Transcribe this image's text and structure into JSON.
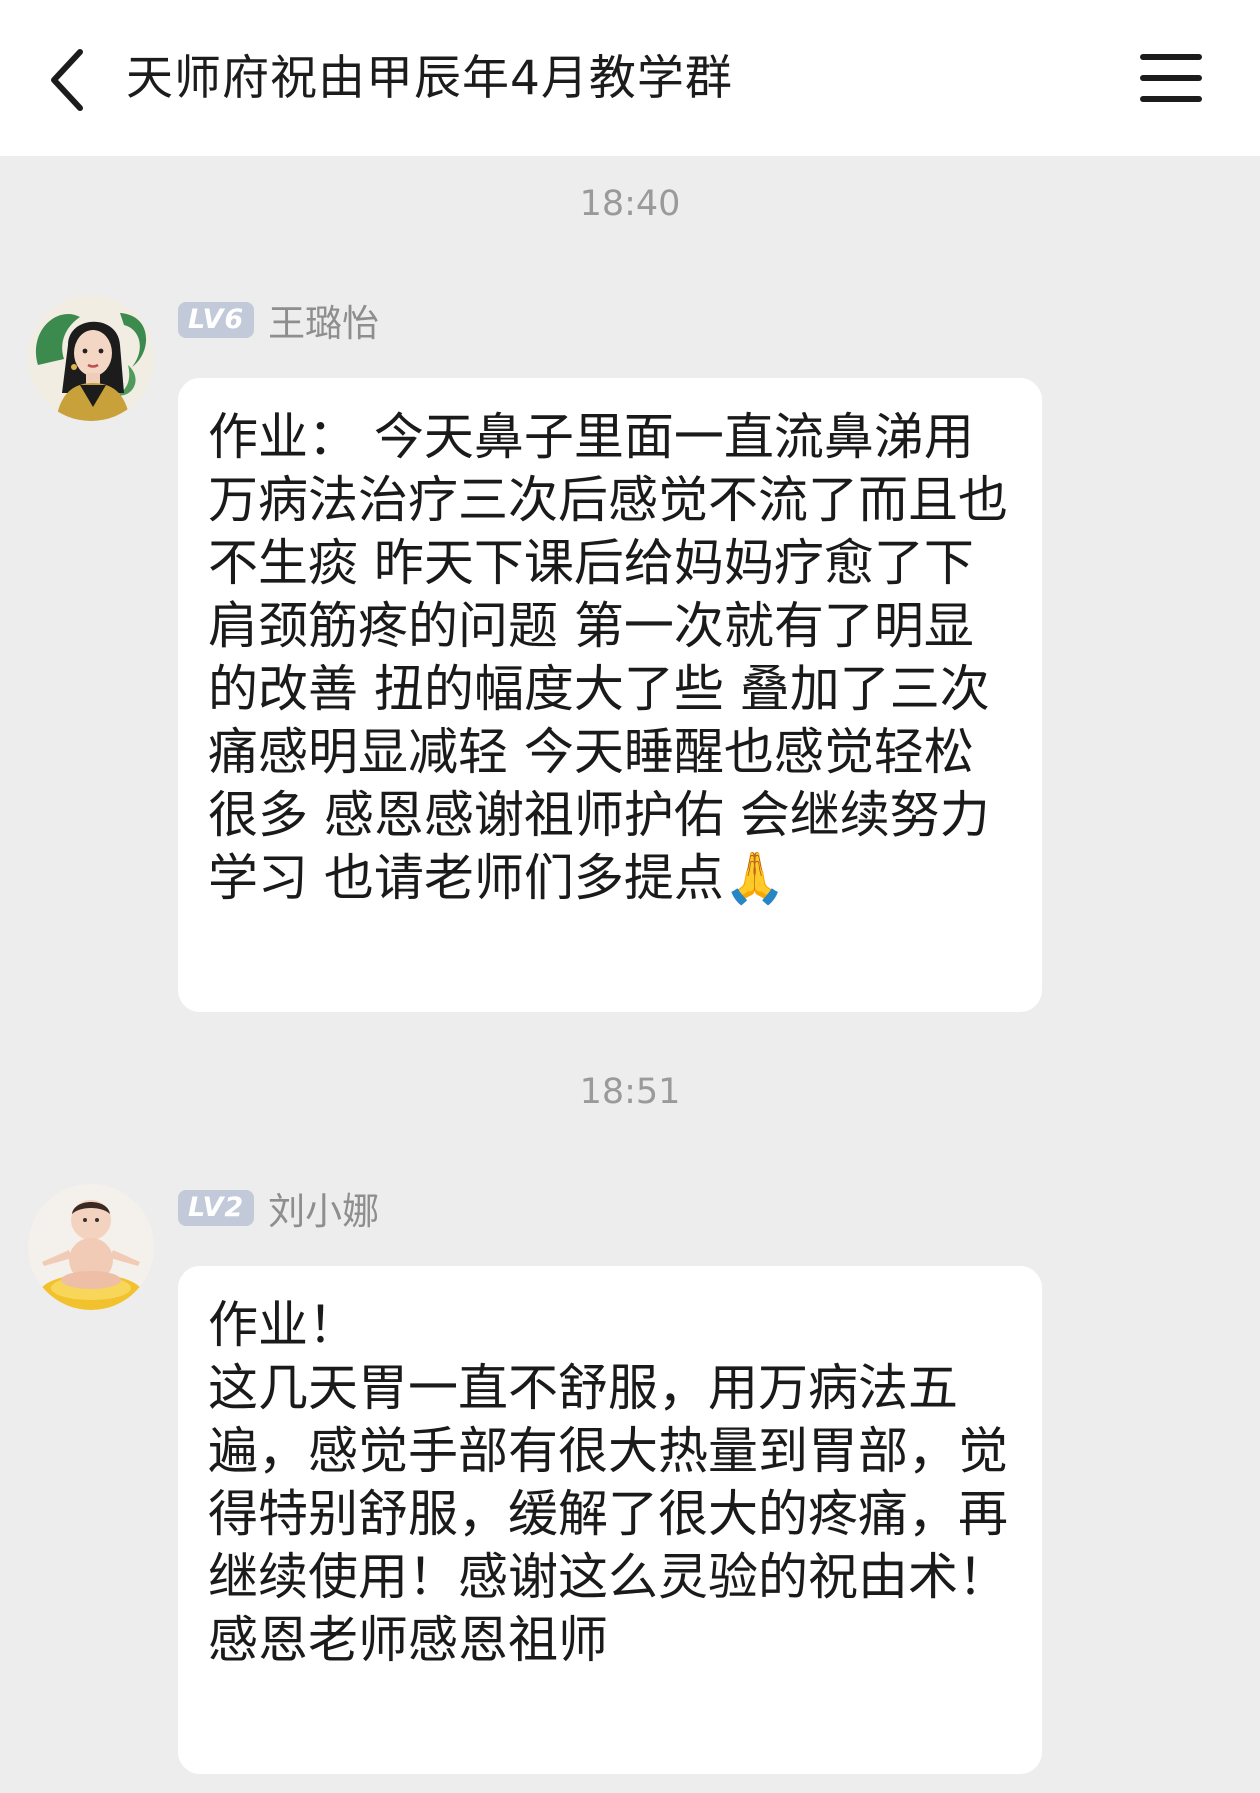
{
  "header": {
    "title": "天师府祝由甲辰年4月教学群",
    "back_icon": "chevron-left-icon",
    "menu_icon": "hamburger-menu-icon"
  },
  "messages": [
    {
      "time": "18:40",
      "level": "LV6",
      "sender": "王璐怡",
      "avatar": "avatar-woman-dragon",
      "text": "作业： 今天鼻子里面一直流鼻涕用万病法治疗三次后感觉不流了而且也不生痰 昨天下课后给妈妈疗愈了下肩颈筋疼的问题 第一次就有了明显的改善 扭的幅度大了些 叠加了三次 痛感明显减轻 今天睡醒也感觉轻松很多 感恩感谢祖师护佑 会继续努力学习 也请老师们多提点🙏"
    },
    {
      "time": "18:51",
      "level": "LV2",
      "sender": "刘小娜",
      "avatar": "avatar-baby-meditating",
      "text": "作业！\n这几天胃一直不舒服，用万病法五遍，感觉手部有很大热量到胃部，觉得特别舒服，缓解了很大的疼痛，再继续使用！感谢这么灵验的祝由术！感恩老师感恩祖师"
    }
  ]
}
